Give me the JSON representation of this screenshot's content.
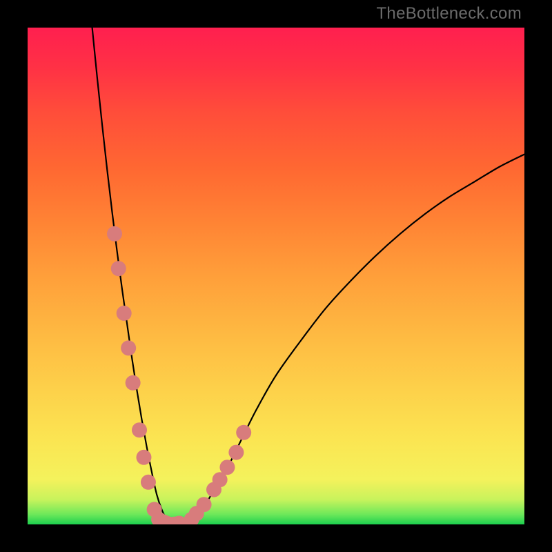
{
  "watermark": "TheBottleneck.com",
  "colors": {
    "frame": "#000000",
    "curve": "#000000",
    "dot_fill": "#d87c7c",
    "dot_stroke": "#000000"
  },
  "chart_data": {
    "type": "line",
    "title": "",
    "xlabel": "",
    "ylabel": "",
    "xlim": [
      0,
      100
    ],
    "ylim": [
      0,
      100
    ],
    "grid": false,
    "series": [
      {
        "name": "curve",
        "x": [
          13,
          14,
          15,
          16,
          17,
          18,
          19,
          20,
          21,
          22,
          23,
          24,
          25,
          26,
          27,
          28,
          29,
          30,
          31,
          33,
          35,
          37,
          40,
          43,
          46,
          50,
          55,
          60,
          65,
          70,
          75,
          80,
          85,
          90,
          95,
          100
        ],
        "y": [
          100,
          90,
          80.5,
          71.5,
          63,
          55,
          47.5,
          40.5,
          33.5,
          27,
          21,
          15.5,
          10.5,
          6,
          3,
          1,
          0.2,
          0,
          0.3,
          1.1,
          3,
          6,
          11,
          17,
          23,
          30,
          37,
          43.5,
          49,
          54,
          58.5,
          62.5,
          66,
          69,
          72,
          74.5
        ]
      },
      {
        "name": "dots-left",
        "x": [
          17.5,
          18.3,
          19.4,
          20.3,
          21.2,
          22.5,
          23.4,
          24.3,
          25.5,
          26.4,
          27.3
        ],
        "y": [
          58.5,
          51.5,
          42.5,
          35.5,
          28.5,
          19.0,
          13.5,
          8.5,
          3.0,
          1.0,
          0.5
        ]
      },
      {
        "name": "dots-right",
        "x": [
          30.5,
          33.0,
          34.0,
          35.5,
          37.5,
          38.7,
          40.2,
          42.0,
          43.5
        ],
        "y": [
          0.2,
          1.0,
          2.2,
          4.0,
          7.0,
          9.0,
          11.5,
          14.5,
          18.5
        ]
      },
      {
        "name": "dots-bottom",
        "x": [
          27.3,
          28.0,
          28.8,
          29.6,
          30.5
        ],
        "y": [
          0.5,
          0.2,
          0.0,
          0.05,
          0.2
        ]
      }
    ]
  }
}
